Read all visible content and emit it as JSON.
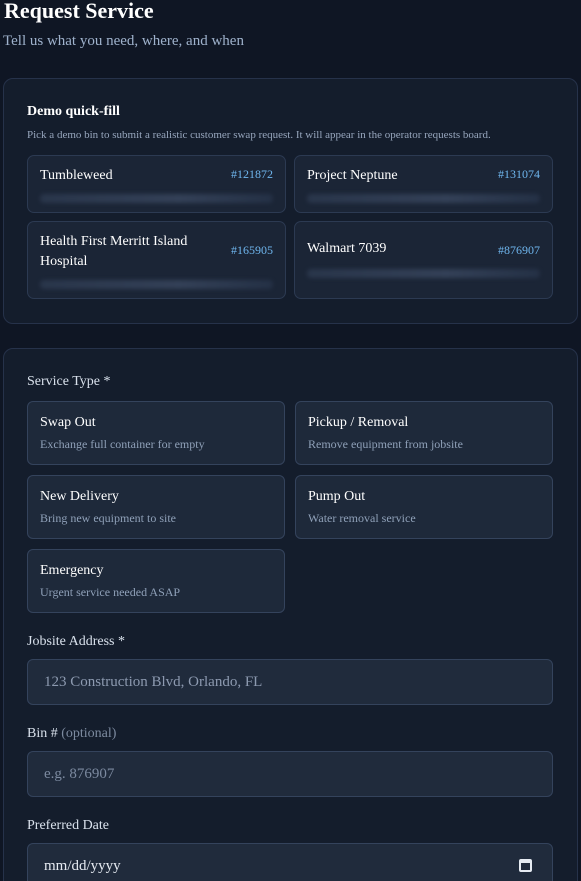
{
  "header": {
    "title": "Request Service",
    "subtitle": "Tell us what you need, where, and when"
  },
  "demo": {
    "title": "Demo quick-fill",
    "description": "Pick a demo bin to submit a realistic customer swap request. It will appear in the operator requests board.",
    "bins": [
      {
        "name": "Tumbleweed",
        "number": "#121872"
      },
      {
        "name": "Project Neptune",
        "number": "#131074"
      },
      {
        "name": "Health First Merritt Island Hospital",
        "number": "#165905"
      },
      {
        "name": "Walmart 7039",
        "number": "#876907"
      }
    ]
  },
  "form": {
    "service_type_label": "Service Type *",
    "service_types": [
      {
        "title": "Swap Out",
        "desc": "Exchange full container for empty"
      },
      {
        "title": "Pickup / Removal",
        "desc": "Remove equipment from jobsite"
      },
      {
        "title": "New Delivery",
        "desc": "Bring new equipment to site"
      },
      {
        "title": "Pump Out",
        "desc": "Water removal service"
      },
      {
        "title": "Emergency",
        "desc": "Urgent service needed ASAP"
      }
    ],
    "address_label": "Jobsite Address *",
    "address_placeholder": "123 Construction Blvd, Orlando, FL",
    "bin_label": "Bin #",
    "bin_optional": "(optional)",
    "bin_placeholder": "e.g. 876907",
    "date_label": "Preferred Date",
    "date_placeholder": "mm/dd/yyyy"
  },
  "icons": {
    "date_picker": "calendar-icon"
  }
}
